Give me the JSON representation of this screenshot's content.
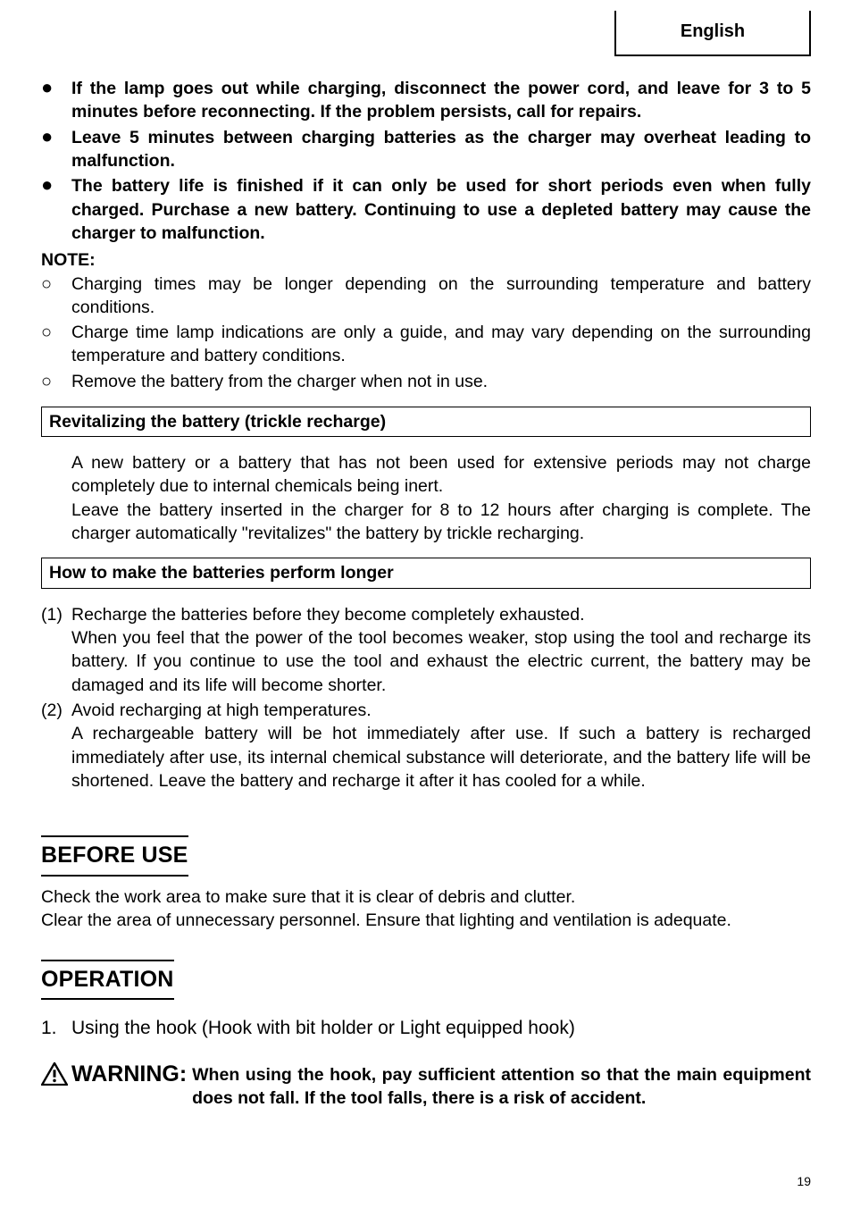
{
  "language_label": "English",
  "bold_bullets": [
    "If the lamp goes out while charging, disconnect the power cord, and leave for 3 to 5 minutes before reconnecting. If the problem persists, call for repairs.",
    "Leave 5 minutes between charging batteries as the charger may overheat leading to malfunction.",
    "The battery life is finished if it can only be used for short periods even when fully charged. Purchase a new battery. Continuing to use a depleted battery may cause the charger to malfunction."
  ],
  "note_label": "NOTE:",
  "notes": [
    "Charging times may be longer depending on the surrounding temperature and battery conditions.",
    "Charge time lamp indications are only a guide, and may vary depending on the surrounding temperature and battery conditions.",
    "Remove the battery from the charger when not in use."
  ],
  "box1_title": "Revitalizing the battery (trickle recharge)",
  "box1_para1": "A new battery or a battery that has not been used for extensive periods may not charge completely due to internal chemicals being inert.",
  "box1_para2": "Leave the battery inserted in the charger for 8 to 12 hours after charging is complete. The charger automatically \"revitalizes\" the battery by trickle recharging.",
  "box2_title": "How to make the batteries perform longer",
  "numbered": [
    {
      "n": "(1)",
      "head": "Recharge the batteries before they become completely exhausted.",
      "body": "When you feel that the power of the tool becomes weaker, stop using the tool and recharge its battery. If you continue to use the tool and exhaust the electric current, the battery may be damaged and its life will become shorter."
    },
    {
      "n": "(2)",
      "head": "Avoid recharging at high temperatures.",
      "body": "A rechargeable battery will be hot immediately after use. If such a battery is recharged immediately after use, its internal chemical substance will deteriorate, and the battery life will be shortened. Leave the battery and recharge it after it has cooled for a while."
    }
  ],
  "section_before_title": "BEFORE USE",
  "before_p1": "Check the work area to make sure that it is clear of debris and clutter.",
  "before_p2": "Clear the area of unnecessary personnel. Ensure that lighting and ventilation is adequate.",
  "section_op_title": "OPERATION",
  "op_step_n": "1.",
  "op_step_text": "Using the hook (Hook with bit holder or Light equipped hook)",
  "warning_lead": "WARNING:",
  "warning_text": "When using the hook, pay sufficient attention so that the main equipment does not fall. If the tool falls, there is a risk of accident.",
  "page_number": "19"
}
